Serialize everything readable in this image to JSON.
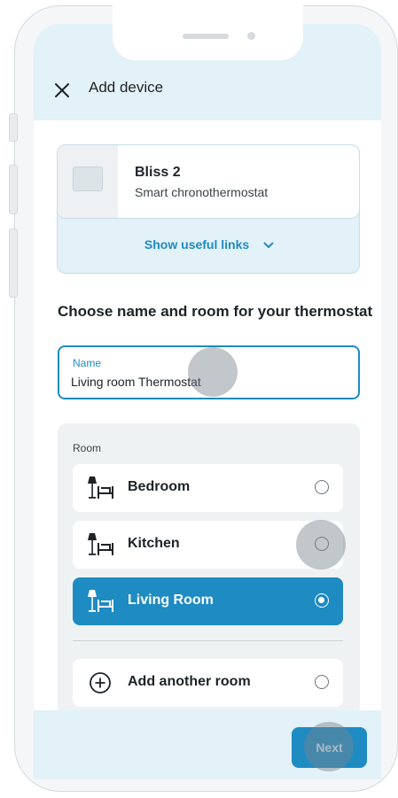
{
  "header": {
    "title": "Add device",
    "close_icon": "close-icon"
  },
  "device": {
    "name": "Bliss 2",
    "subtitle": "Smart chronothermostat",
    "links_label": "Show useful links",
    "links_icon": "chevron-down-icon"
  },
  "section_title": "Choose name and room for your thermostat",
  "name_field": {
    "label": "Name",
    "value": "Living room Thermostat"
  },
  "room": {
    "label": "Room",
    "items": [
      {
        "label": "Bedroom",
        "icon": "room-icon",
        "selected": false
      },
      {
        "label": "Kitchen",
        "icon": "room-icon",
        "selected": false
      },
      {
        "label": "Living Room",
        "icon": "room-icon",
        "selected": true
      }
    ],
    "add_label": "Add another room",
    "add_icon": "plus-circle-icon"
  },
  "footer": {
    "next_label": "Next"
  },
  "colors": {
    "accent": "#1e8bc3",
    "header_bg": "#e3f1f8"
  }
}
